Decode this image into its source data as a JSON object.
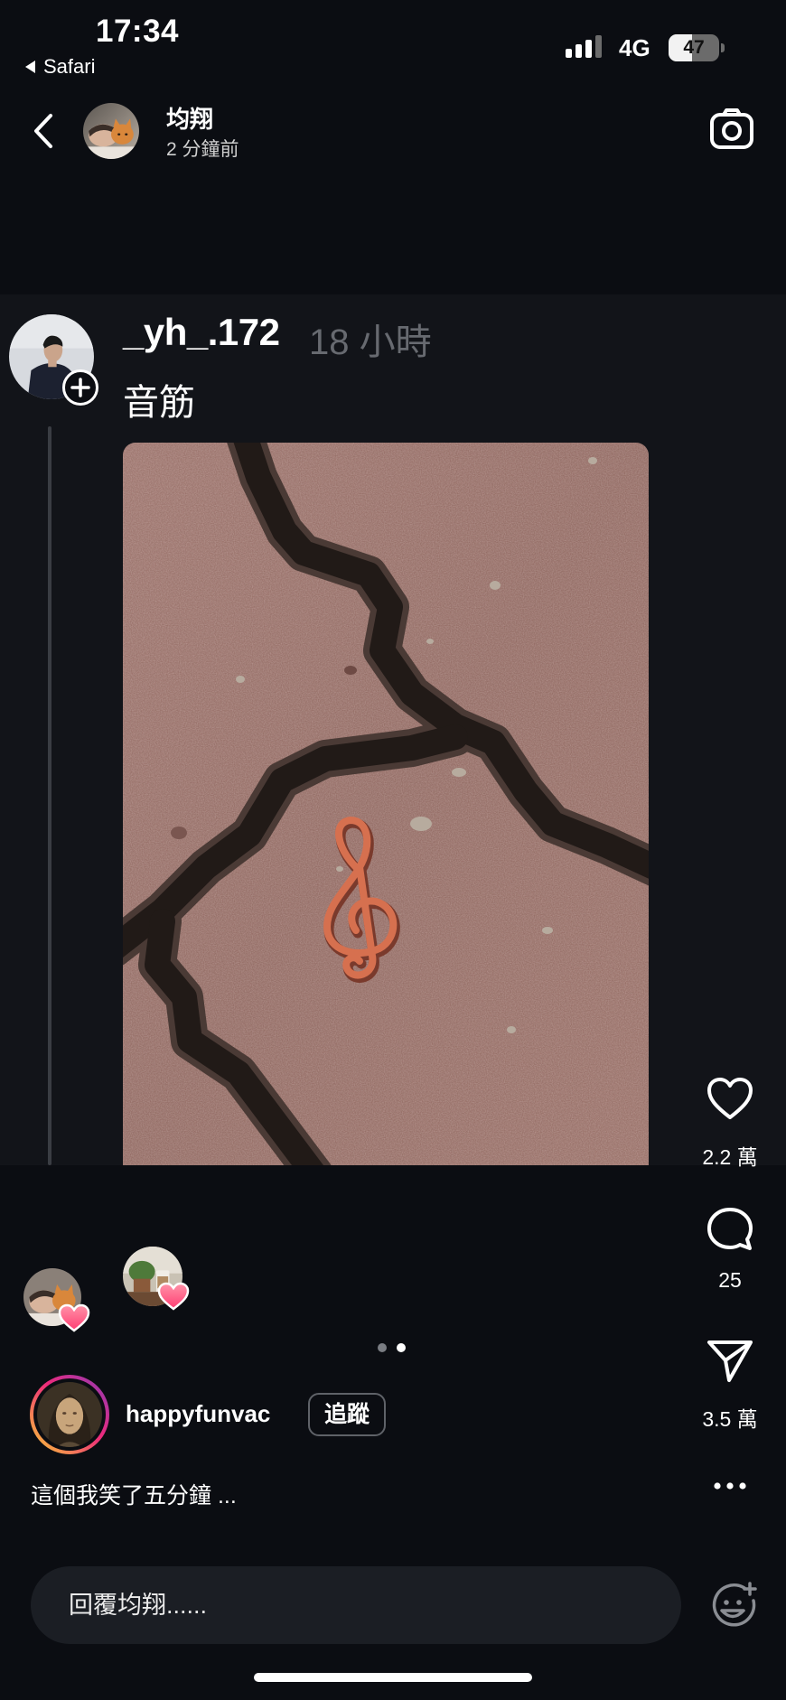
{
  "status_bar": {
    "time": "17:34",
    "back_app": "Safari",
    "network": "4G",
    "battery_level": "47",
    "battery_fraction": 0.47
  },
  "header": {
    "name": "均翔",
    "subtitle": "2 分鐘前"
  },
  "post": {
    "username": "_yh_.172",
    "time": "18 小時",
    "caption": "音筋"
  },
  "actions": {
    "likes": "2.2 萬",
    "comments": "25",
    "shares": "3.5 萬"
  },
  "carousel": {
    "page_count": 2,
    "current_page": 2
  },
  "author": {
    "username": "happyfunvac",
    "follow_label": "追蹤",
    "caption": "這個我笑了五分鐘 ..."
  },
  "reply": {
    "placeholder": "回覆均翔......"
  },
  "icons": [
    "back-triangle-icon",
    "signal-icon",
    "battery-icon",
    "back-chevron-icon",
    "camera-icon",
    "plus-icon",
    "heart-icon",
    "comment-icon",
    "send-icon",
    "more-icon",
    "emoji-add-icon",
    "reaction-heart-icon"
  ],
  "colors": {
    "background": "#0b0d12",
    "panel": "#121419",
    "muted_text": "#676a70",
    "reaction_heart": "#ff4f7e",
    "story_ring_start": "#f9ce34",
    "story_ring_end": "#8a3ab9"
  }
}
